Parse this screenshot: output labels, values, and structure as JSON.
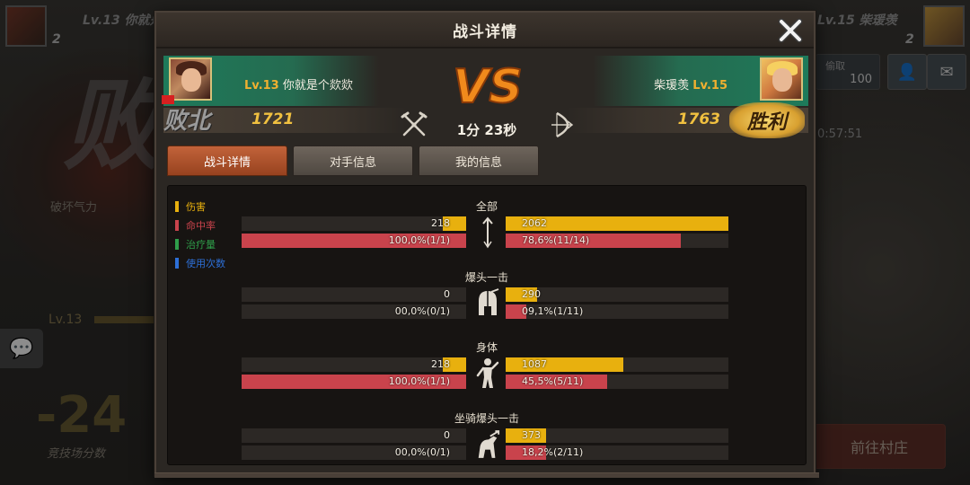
{
  "colors": {
    "damage": "#e8b00e",
    "hit_rate": "#c9434c",
    "heal": "#2f9e4a",
    "use_count": "#2d6fd6",
    "accent_tab": "#b5532c"
  },
  "background": {
    "left_rank": "Lv.13 你就是",
    "left_badge": "2",
    "right_rank": "Lv.15 柴瑗羡",
    "right_badge": "2",
    "big_result": "败",
    "break_energy": "破坏气力",
    "level": "Lv.13",
    "score_delta": "-24",
    "score_label": "竞技场分数",
    "steal_label": "偷取",
    "steal_value": "100",
    "timer": "0:57:51",
    "goto_village": "前往村庄",
    "chat_icon": "chat-bubble-icon",
    "add_friend_icon": "add-friend-icon",
    "mail_icon": "mail-icon"
  },
  "modal": {
    "title": "战斗详情",
    "close_icon": "close-icon",
    "left_player": {
      "level": "Lv.13",
      "name": "你就是个欻欻",
      "score": "1721",
      "result": "败北"
    },
    "right_player": {
      "level": "Lv.15",
      "name": "柴瑗羡",
      "score": "1763",
      "result": "胜利"
    },
    "vs": "VS",
    "duration": "1分 23秒",
    "tabs": [
      {
        "label": "战斗详情",
        "active": true
      },
      {
        "label": "对手信息",
        "active": false
      },
      {
        "label": "我的信息",
        "active": false
      }
    ],
    "legend": [
      {
        "label": "伤害",
        "color": "#e8b00e"
      },
      {
        "label": "命中率",
        "color": "#c9434c"
      },
      {
        "label": "治疗量",
        "color": "#2f9e4a"
      },
      {
        "label": "使用次数",
        "color": "#2d6fd6"
      }
    ],
    "sections": [
      {
        "title": "全部",
        "icon": "arrow-icon",
        "damage_left": "218",
        "damage_left_pct": 0.1057,
        "damage_right": "2062",
        "damage_right_pct": 1.0,
        "hit_left": "100,0%(1/1)",
        "hit_left_pct": 1.0,
        "hit_right": "78,6%(11/14)",
        "hit_right_pct": 0.786
      },
      {
        "title": "爆头一击",
        "icon": "helmet-icon",
        "damage_left": "0",
        "damage_left_pct": 0.0,
        "damage_right": "290",
        "damage_right_pct": 0.1406,
        "hit_left": "00,0%(0/1)",
        "hit_left_pct": 0.0,
        "hit_right": "09,1%(1/11)",
        "hit_right_pct": 0.091
      },
      {
        "title": "身体",
        "icon": "body-icon",
        "damage_left": "218",
        "damage_left_pct": 0.1057,
        "damage_right": "1087",
        "damage_right_pct": 0.5272,
        "hit_left": "100,0%(1/1)",
        "hit_left_pct": 1.0,
        "hit_right": "45,5%(5/11)",
        "hit_right_pct": 0.455
      },
      {
        "title": "坐骑爆头一击",
        "icon": "mount-icon",
        "damage_left": "0",
        "damage_left_pct": 0.0,
        "damage_right": "373",
        "damage_right_pct": 0.1809,
        "hit_left": "00,0%(0/1)",
        "hit_left_pct": 0.0,
        "hit_right": "18,2%(2/11)",
        "hit_right_pct": 0.182
      }
    ]
  }
}
